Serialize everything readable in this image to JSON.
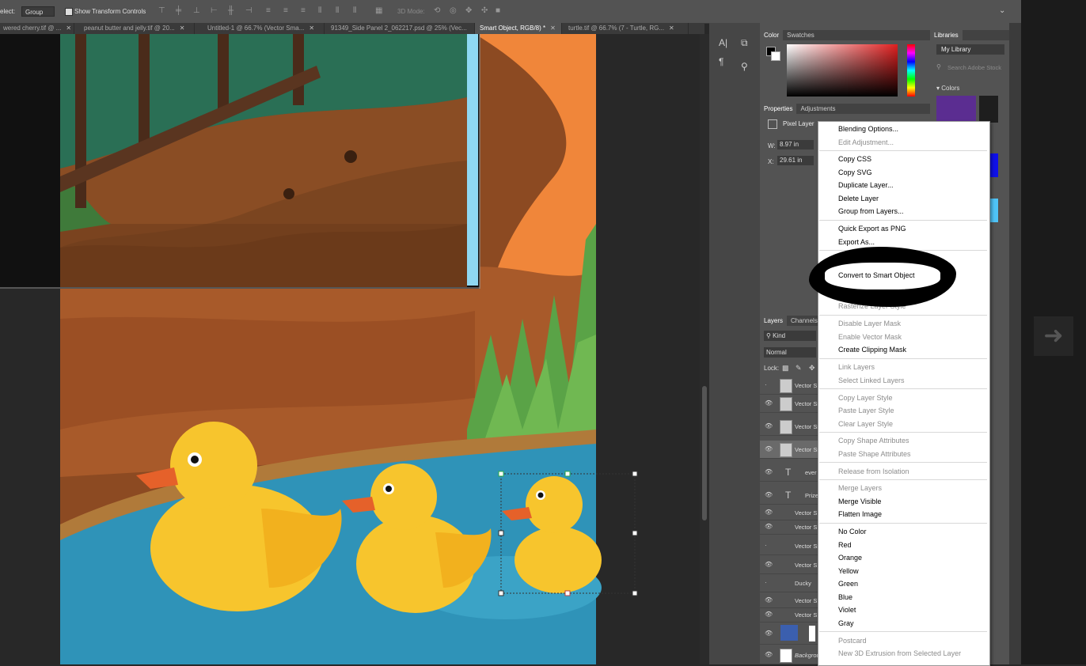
{
  "options_bar": {
    "select_label": "elect:",
    "group_value": "Group",
    "show_transform_label": "Show Transform Controls",
    "mode_3d": "3D Mode:"
  },
  "tabs": [
    {
      "label": "wered cherry.tif @ ...",
      "active": false
    },
    {
      "label": "peanut butter and jelly.tif @ 20...",
      "active": false
    },
    {
      "label": "Untitled-1 @ 66.7% (Vector Sma...",
      "active": false
    },
    {
      "label": "91349_Side Panel 2_062217.psd @ 25% (Vec...",
      "active": false
    },
    {
      "label": "Smart Object, RGB/8) *",
      "active": true
    },
    {
      "label": "turtle.tif @ 66.7% (7 - Turtle, RG...",
      "active": false
    }
  ],
  "color_panel": {
    "tabs": [
      "Color",
      "Swatches"
    ]
  },
  "libraries": {
    "title": "Libraries",
    "library": "My Library",
    "search_placeholder": "Search Adobe Stock",
    "section": "Colors"
  },
  "properties": {
    "tabs": [
      "Properties",
      "Adjustments"
    ],
    "kind": "Pixel Layer",
    "w_label": "W:",
    "w_value": "8.97 in",
    "x_label": "X:",
    "x_value": "29.61 in"
  },
  "layers_panel": {
    "tabs": [
      "Layers",
      "Channels"
    ],
    "filter": "Kind",
    "blend": "Normal",
    "lock_label": "Lock:",
    "rows": [
      "Vector S",
      "Vector Sr",
      "Vector Sr",
      "Vector Sr",
      "ever",
      "Prize",
      "Vector S",
      "Vector S",
      "Vector Sr",
      "Vector S",
      "Ducky",
      "Vector S",
      "Vector S",
      "",
      "Backgrou"
    ]
  },
  "context_menu": {
    "groups": [
      [
        {
          "label": "Blending Options...",
          "enabled": true
        },
        {
          "label": "Edit Adjustment...",
          "enabled": false
        }
      ],
      [
        {
          "label": "Copy CSS",
          "enabled": true
        },
        {
          "label": "Copy SVG",
          "enabled": true
        },
        {
          "label": "Duplicate Layer...",
          "enabled": true
        },
        {
          "label": "Delete Layer",
          "enabled": true
        },
        {
          "label": "Group from Layers...",
          "enabled": true
        }
      ],
      [
        {
          "label": "Quick Export as PNG",
          "enabled": true
        },
        {
          "label": "Export As...",
          "enabled": true
        }
      ],
      [
        {
          "label": "Disable Layer Mask",
          "enabled": false
        },
        {
          "label": "Enable Vector Mask",
          "enabled": false
        },
        {
          "label": "Create Clipping Mask",
          "enabled": true
        }
      ],
      [
        {
          "label": "Link Layers",
          "enabled": false
        },
        {
          "label": "Select Linked Layers",
          "enabled": false
        }
      ],
      [
        {
          "label": "Copy Layer Style",
          "enabled": false
        },
        {
          "label": "Paste Layer Style",
          "enabled": false
        },
        {
          "label": "Clear Layer Style",
          "enabled": false
        }
      ],
      [
        {
          "label": "Copy Shape Attributes",
          "enabled": false
        },
        {
          "label": "Paste Shape Attributes",
          "enabled": false
        }
      ],
      [
        {
          "label": "Release from Isolation",
          "enabled": false
        }
      ],
      [
        {
          "label": "Merge Layers",
          "enabled": false
        },
        {
          "label": "Merge Visible",
          "enabled": true
        },
        {
          "label": "Flatten Image",
          "enabled": true
        }
      ],
      [
        {
          "label": "No Color",
          "enabled": true
        },
        {
          "label": "Red",
          "enabled": true
        },
        {
          "label": "Orange",
          "enabled": true
        },
        {
          "label": "Yellow",
          "enabled": true
        },
        {
          "label": "Green",
          "enabled": true
        },
        {
          "label": "Blue",
          "enabled": true
        },
        {
          "label": "Violet",
          "enabled": true
        },
        {
          "label": "Gray",
          "enabled": true
        }
      ],
      [
        {
          "label": "Postcard",
          "enabled": false
        },
        {
          "label": "New 3D Extrusion from Selected Layer",
          "enabled": false
        }
      ]
    ],
    "highlighted": "Convert to Smart Object",
    "obscured_partial": "Rasterize Layer Style"
  },
  "colors": {
    "accent_menu_bg": "#ffffff",
    "pond": "#2f93b8",
    "duck": "#f7c52d",
    "swatch_purple": "#5b2d91"
  }
}
